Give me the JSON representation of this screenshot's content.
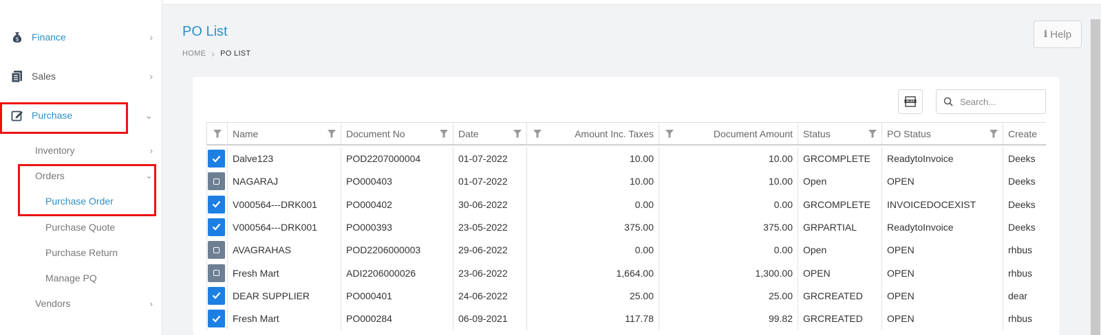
{
  "colors": {
    "accent": "#2e8fc8",
    "highlight": "#ee1111",
    "checked": "#1e7fe3",
    "unchecked": "#6d7f93"
  },
  "sidebar": {
    "finance": {
      "label": "Finance",
      "icon": "money-bag-icon"
    },
    "sales": {
      "label": "Sales",
      "icon": "document-list-icon"
    },
    "purchase": {
      "label": "Purchase",
      "icon": "edit-square-icon"
    },
    "inventory": "Inventory",
    "orders": "Orders",
    "purchase_order": "Purchase Order",
    "purchase_quote": "Purchase Quote",
    "purchase_return": "Purchase Return",
    "manage_pq": "Manage PQ",
    "vendors": "Vendors"
  },
  "header": {
    "title": "PO List",
    "breadcrumb": {
      "home": "HOME",
      "current": "PO LIST"
    },
    "help": "Help"
  },
  "toolbar": {
    "export_icon": "xlsx-export-icon",
    "search_placeholder": "Search..."
  },
  "table": {
    "columns": [
      "Name",
      "Document No",
      "Date",
      "Amount Inc. Taxes",
      "Document Amount",
      "Status",
      "PO Status",
      "Create"
    ],
    "rows": [
      {
        "checked": true,
        "name": "Dalve123",
        "doc": "POD2207000004",
        "date": "01-07-2022",
        "amt": "10.00",
        "docamt": "10.00",
        "status": "GRCOMPLETE",
        "po": "ReadytoInvoice",
        "created": "Deeks"
      },
      {
        "checked": false,
        "name": "NAGARAJ",
        "doc": "PO000403",
        "date": "01-07-2022",
        "amt": "10.00",
        "docamt": "10.00",
        "status": "Open",
        "po": "OPEN",
        "created": "Deeks"
      },
      {
        "checked": true,
        "name": "V000564---DRK001",
        "doc": "PO000402",
        "date": "30-06-2022",
        "amt": "0.00",
        "docamt": "0.00",
        "status": "GRCOMPLETE",
        "po": "INVOICEDOCEXIST",
        "created": "Deeks"
      },
      {
        "checked": true,
        "name": "V000564---DRK001",
        "doc": "PO000393",
        "date": "23-05-2022",
        "amt": "375.00",
        "docamt": "375.00",
        "status": "GRPARTIAL",
        "po": "ReadytoInvoice",
        "created": "Deeks"
      },
      {
        "checked": false,
        "name": "AVAGRAHAS",
        "doc": "POD2206000003",
        "date": "29-06-2022",
        "amt": "0.00",
        "docamt": "0.00",
        "status": "Open",
        "po": "OPEN",
        "created": "rhbus"
      },
      {
        "checked": false,
        "name": "Fresh Mart",
        "doc": "ADI2206000026",
        "date": "23-06-2022",
        "amt": "1,664.00",
        "docamt": "1,300.00",
        "status": "OPEN",
        "po": "OPEN",
        "created": "rhbus"
      },
      {
        "checked": true,
        "name": "DEAR SUPPLIER",
        "doc": "PO000401",
        "date": "24-06-2022",
        "amt": "25.00",
        "docamt": "25.00",
        "status": "GRCREATED",
        "po": "OPEN",
        "created": "dear"
      },
      {
        "checked": true,
        "name": "Fresh Mart",
        "doc": "PO000284",
        "date": "06-09-2021",
        "amt": "117.78",
        "docamt": "99.82",
        "status": "GRCREATED",
        "po": "OPEN",
        "created": "rhbus"
      }
    ]
  }
}
